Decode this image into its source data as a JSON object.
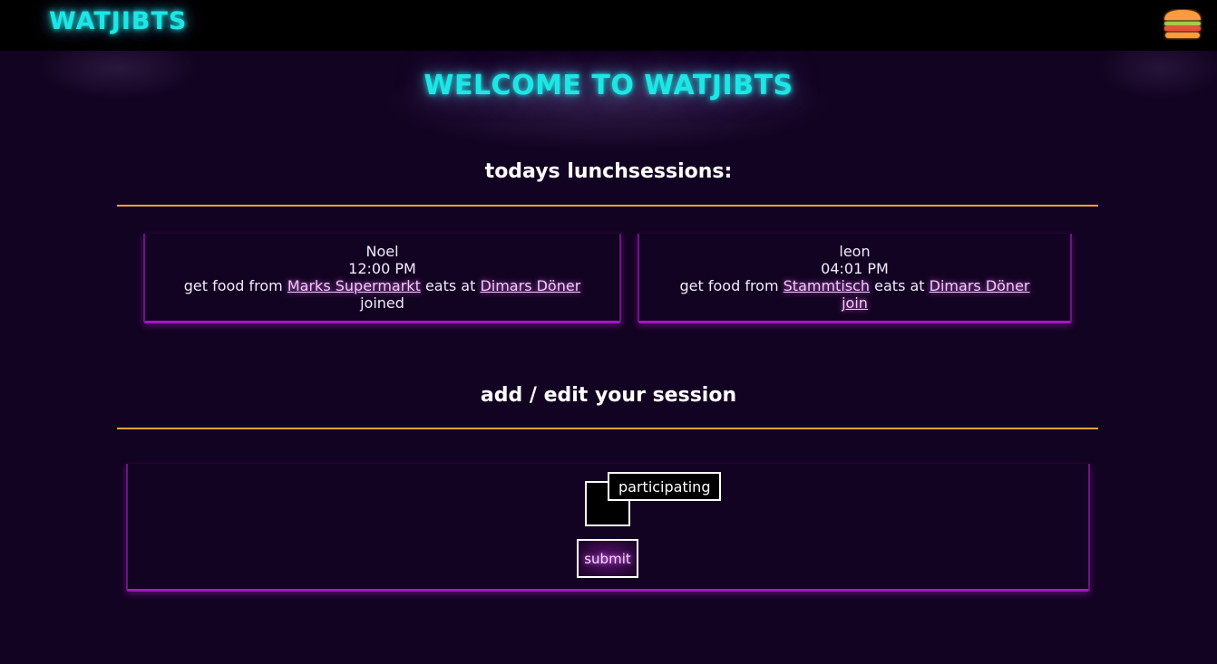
{
  "header": {
    "brand": "WATJIBTS",
    "menu_icon": "burger-icon"
  },
  "welcome": "WELCOME TO WATJIBTS",
  "sessions": {
    "title": "todays lunchsessions:",
    "items": [
      {
        "name": "Noel",
        "time": "12:00 PM",
        "get_food_text": "get food from",
        "food_place": "Marks Supermarkt",
        "eats_at_text": "eats at",
        "eat_place": "Dimars Döner",
        "status": "joined"
      },
      {
        "name": "leon",
        "time": "04:01 PM",
        "get_food_text": "get food from",
        "food_place": "Stammtisch",
        "eats_at_text": "eats at",
        "eat_place": "Dimars Döner",
        "action": "join"
      }
    ]
  },
  "form": {
    "title": "add / edit your session",
    "participating_label": "participating",
    "participating_checked": false,
    "submit_label": "submit"
  },
  "colors": {
    "background": "#130322",
    "neon_cyan": "#1ee6e6",
    "divider_orange": "#e8a23a",
    "card_magenta": "#a417c2",
    "link_pink": "#f6c6ff"
  }
}
